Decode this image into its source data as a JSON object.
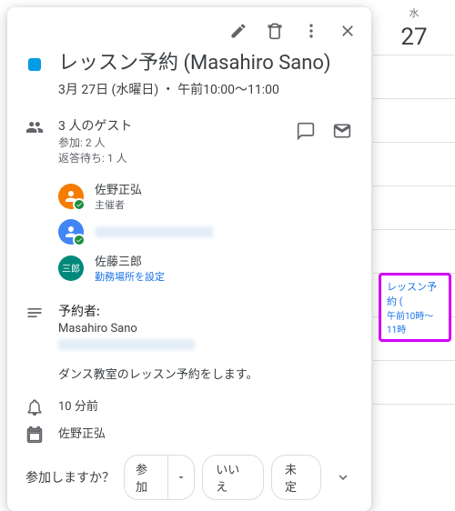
{
  "calendar": {
    "weekday": "水",
    "day_number": "27",
    "event_chip": {
      "title": "レッスン予約 (",
      "time": "午前10時～11時"
    }
  },
  "toolbar": {
    "edit": "edit",
    "delete": "delete",
    "more": "more",
    "close": "close"
  },
  "event": {
    "title": "レッスン予約 (Masahiro Sano)",
    "datetime": "3月 27日 (水曜日) ・ 午前10:00～11:00"
  },
  "guests": {
    "summary": "3 人のゲスト",
    "yes_count": "参加: 2 人",
    "awaiting": "返答待ち: 1 人",
    "items": [
      {
        "name": "佐野正弘",
        "role": "主催者",
        "avatar_bg": "#f57c00",
        "badge": true
      },
      {
        "name": "",
        "role": "",
        "avatar_bg": "#4285f4",
        "badge": true,
        "blurred": true
      },
      {
        "name": "佐藤三郎",
        "role_link": "勤務場所を設定",
        "avatar_bg": "#00897b",
        "avatar_text": "三郎"
      }
    ]
  },
  "description": {
    "label": "予約者:",
    "booker": "Masahiro Sano",
    "body": "ダンス教室のレッスン予約をします。"
  },
  "reminder": {
    "text": "10 分前"
  },
  "calendar_owner": {
    "text": "佐野正弘"
  },
  "rsvp": {
    "prompt": "参加しますか？",
    "yes": "参加",
    "no": "いいえ",
    "maybe": "未定"
  }
}
